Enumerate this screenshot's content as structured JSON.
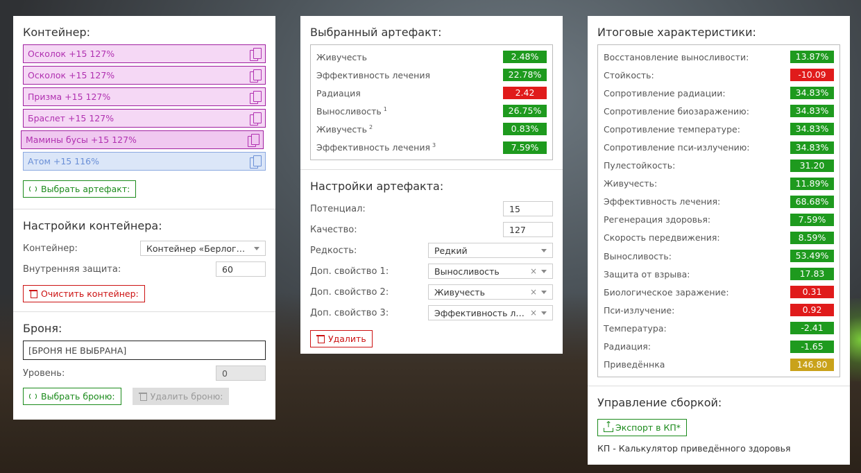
{
  "container": {
    "title": "Контейнер:",
    "items": [
      {
        "label": "Осколок +15 127%",
        "type": "pink"
      },
      {
        "label": "Осколок +15 127%",
        "type": "pink"
      },
      {
        "label": "Призма +15 127%",
        "type": "pink"
      },
      {
        "label": "Браслет +15 127%",
        "type": "pink"
      },
      {
        "label": "Мамины бусы +15 127%",
        "type": "pink-active"
      },
      {
        "label": "Атом +15 116%",
        "type": "blue"
      }
    ],
    "select_button": "Выбрать артефакт:"
  },
  "container_settings": {
    "title": "Настройки контейнера:",
    "container_label": "Контейнер:",
    "container_value": "Контейнер «Берлога…",
    "protection_label": "Внутренняя защита:",
    "protection_value": "60",
    "clear_button": "Очистить контейнер:"
  },
  "armor": {
    "title": "Броня:",
    "none_text": "[БРОНЯ НЕ ВЫБРАНА]",
    "level_label": "Уровень:",
    "level_value": "0",
    "select_button": "Выбрать броню:",
    "remove_button": "Удалить броню:"
  },
  "selected_artifact": {
    "title": "Выбранный артефакт:",
    "stats": [
      {
        "name": "Живучесть",
        "sup": "",
        "value": "2.48%",
        "color": "#1e9a1e"
      },
      {
        "name": "Эффективность лечения",
        "sup": "",
        "value": "22.78%",
        "color": "#1e9a1e"
      },
      {
        "name": "Радиация",
        "sup": "",
        "value": "2.42",
        "color": "#e01b1b"
      },
      {
        "name": "Выносливость",
        "sup": "1",
        "value": "26.75%",
        "color": "#1e9a1e"
      },
      {
        "name": "Живучесть",
        "sup": "2",
        "value": "0.83%",
        "color": "#1e9a1e"
      },
      {
        "name": "Эффективность лечения",
        "sup": "3",
        "value": "7.59%",
        "color": "#1e9a1e"
      }
    ]
  },
  "artifact_settings": {
    "title": "Настройки артефакта:",
    "potential_label": "Потенциал:",
    "potential_value": "15",
    "quality_label": "Качество:",
    "quality_value": "127",
    "rarity_label": "Редкость:",
    "rarity_value": "Редкий",
    "prop1_label": "Доп. свойство 1:",
    "prop1_value": "Выносливость",
    "prop2_label": "Доп. свойство 2:",
    "prop2_value": "Живучесть",
    "prop3_label": "Доп. свойство 3:",
    "prop3_value": "Эффективность ле...",
    "delete_button": "Удалить"
  },
  "totals": {
    "title": "Итоговые характеристики:",
    "stats": [
      {
        "name": "Восстановление выносливости:",
        "value": "13.87%",
        "color": "#1e9a1e"
      },
      {
        "name": "Стойкость:",
        "value": "-10.09",
        "color": "#e01b1b"
      },
      {
        "name": "Сопротивление радиации:",
        "value": "34.83%",
        "color": "#1e9a1e"
      },
      {
        "name": "Сопротивление биозаражению:",
        "value": "34.83%",
        "color": "#1e9a1e"
      },
      {
        "name": "Сопротивление температуре:",
        "value": "34.83%",
        "color": "#1e9a1e"
      },
      {
        "name": "Сопротивление пси-излучению:",
        "value": "34.83%",
        "color": "#1e9a1e"
      },
      {
        "name": "Пулестойкость:",
        "value": "31.20",
        "color": "#1e9a1e"
      },
      {
        "name": "Живучесть:",
        "value": "11.89%",
        "color": "#1e9a1e"
      },
      {
        "name": "Эффективность лечения:",
        "value": "68.68%",
        "color": "#1e9a1e"
      },
      {
        "name": "Регенерация здоровья:",
        "value": "7.59%",
        "color": "#1e9a1e"
      },
      {
        "name": "Скорость передвижения:",
        "value": "8.59%",
        "color": "#1e9a1e"
      },
      {
        "name": "Выносливость:",
        "value": "53.49%",
        "color": "#1e9a1e"
      },
      {
        "name": "Защита от взрыва:",
        "value": "17.83",
        "color": "#1e9a1e"
      },
      {
        "name": "Биологическое заражение:",
        "value": "0.31",
        "color": "#e01b1b"
      },
      {
        "name": "Пси-излучение:",
        "value": "0.92",
        "color": "#e01b1b"
      },
      {
        "name": "Температура:",
        "value": "-2.41",
        "color": "#1e9a1e"
      },
      {
        "name": "Радиация:",
        "value": "-1.65",
        "color": "#1e9a1e"
      },
      {
        "name": "Приведённка",
        "value": "146.80",
        "color": "#c9a21a"
      }
    ]
  },
  "build": {
    "title": "Управление сборкой:",
    "export_button": "Экспорт в КП*",
    "note": "КП - Калькулятор приведённого здоровья"
  }
}
